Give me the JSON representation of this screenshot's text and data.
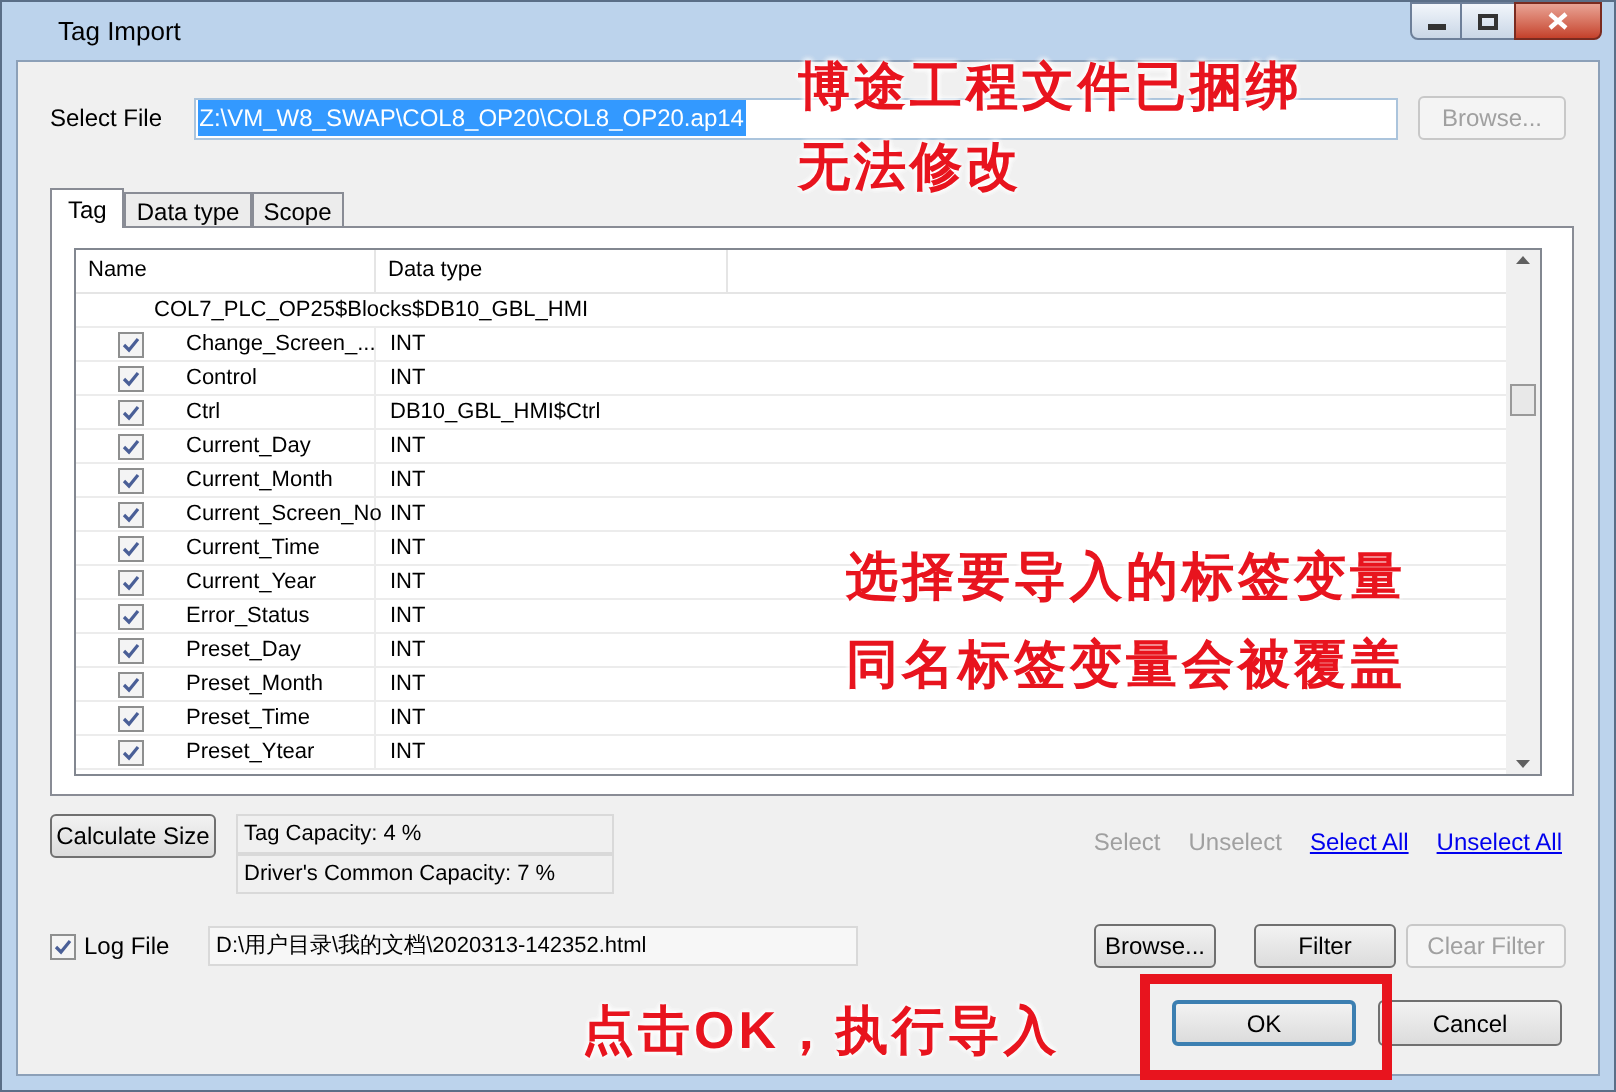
{
  "window": {
    "title": "Tag Import"
  },
  "select_file": {
    "label": "Select File",
    "value": "Z:\\VM_W8_SWAP\\COL8_OP20\\COL8_OP20.ap14",
    "browse": {
      "label": "Browse...",
      "disabled": true
    }
  },
  "tabs": [
    {
      "label": "Tag",
      "selected": true
    },
    {
      "label": "Data type",
      "selected": false
    },
    {
      "label": "Scope",
      "selected": false
    }
  ],
  "table": {
    "columns": [
      "Name",
      "Data type"
    ],
    "groups": [
      {
        "name": "COL7_PLC_OP25$Blocks$DB10_GBL_HMI",
        "children": [
          {
            "name": "Change_Screen_...",
            "type": "INT",
            "checked": true
          },
          {
            "name": "Control",
            "type": "INT",
            "checked": true
          },
          {
            "name": "Ctrl",
            "type": "DB10_GBL_HMI$Ctrl",
            "checked": true
          },
          {
            "name": "Current_Day",
            "type": "INT",
            "checked": true
          },
          {
            "name": "Current_Month",
            "type": "INT",
            "checked": true
          },
          {
            "name": "Current_Screen_No",
            "type": "INT",
            "checked": true
          },
          {
            "name": "Current_Time",
            "type": "INT",
            "checked": true
          },
          {
            "name": "Current_Year",
            "type": "INT",
            "checked": true
          },
          {
            "name": "Error_Status",
            "type": "INT",
            "checked": true
          },
          {
            "name": "Preset_Day",
            "type": "INT",
            "checked": true
          },
          {
            "name": "Preset_Month",
            "type": "INT",
            "checked": true
          },
          {
            "name": "Preset_Time",
            "type": "INT",
            "checked": true
          },
          {
            "name": "Preset_Ytear",
            "type": "INT",
            "checked": true
          }
        ]
      }
    ]
  },
  "calculate_button": "Calculate Size",
  "capacity": [
    "Tag Capacity: 4 %",
    "Driver's Common Capacity: 7 %"
  ],
  "selection_links": [
    {
      "label": "Select",
      "disabled": true
    },
    {
      "label": "Unselect",
      "disabled": true
    },
    {
      "label": "Select All",
      "disabled": false
    },
    {
      "label": "Unselect All",
      "disabled": false
    }
  ],
  "log_file": {
    "label": "Log File",
    "checked": true,
    "value": "D:\\用户目录\\我的文档\\2020313-142352.html"
  },
  "log_buttons": [
    {
      "label": "Browse...",
      "disabled": false
    },
    {
      "label": "Filter",
      "disabled": false
    },
    {
      "label": "Clear Filter",
      "disabled": true
    }
  ],
  "dialog_buttons": [
    {
      "label": "OK",
      "highlighted": true
    },
    {
      "label": "Cancel",
      "highlighted": false
    }
  ],
  "annotations": [
    {
      "kind": "top",
      "lines": [
        "博途工程文件已捆绑",
        "无法修改"
      ]
    },
    {
      "kind": "right",
      "lines": [
        "选择要导入的标签变量",
        "同名标签变量会被覆盖"
      ]
    },
    {
      "kind": "bottom",
      "lines": [
        "点击OK，执行导入"
      ]
    }
  ]
}
